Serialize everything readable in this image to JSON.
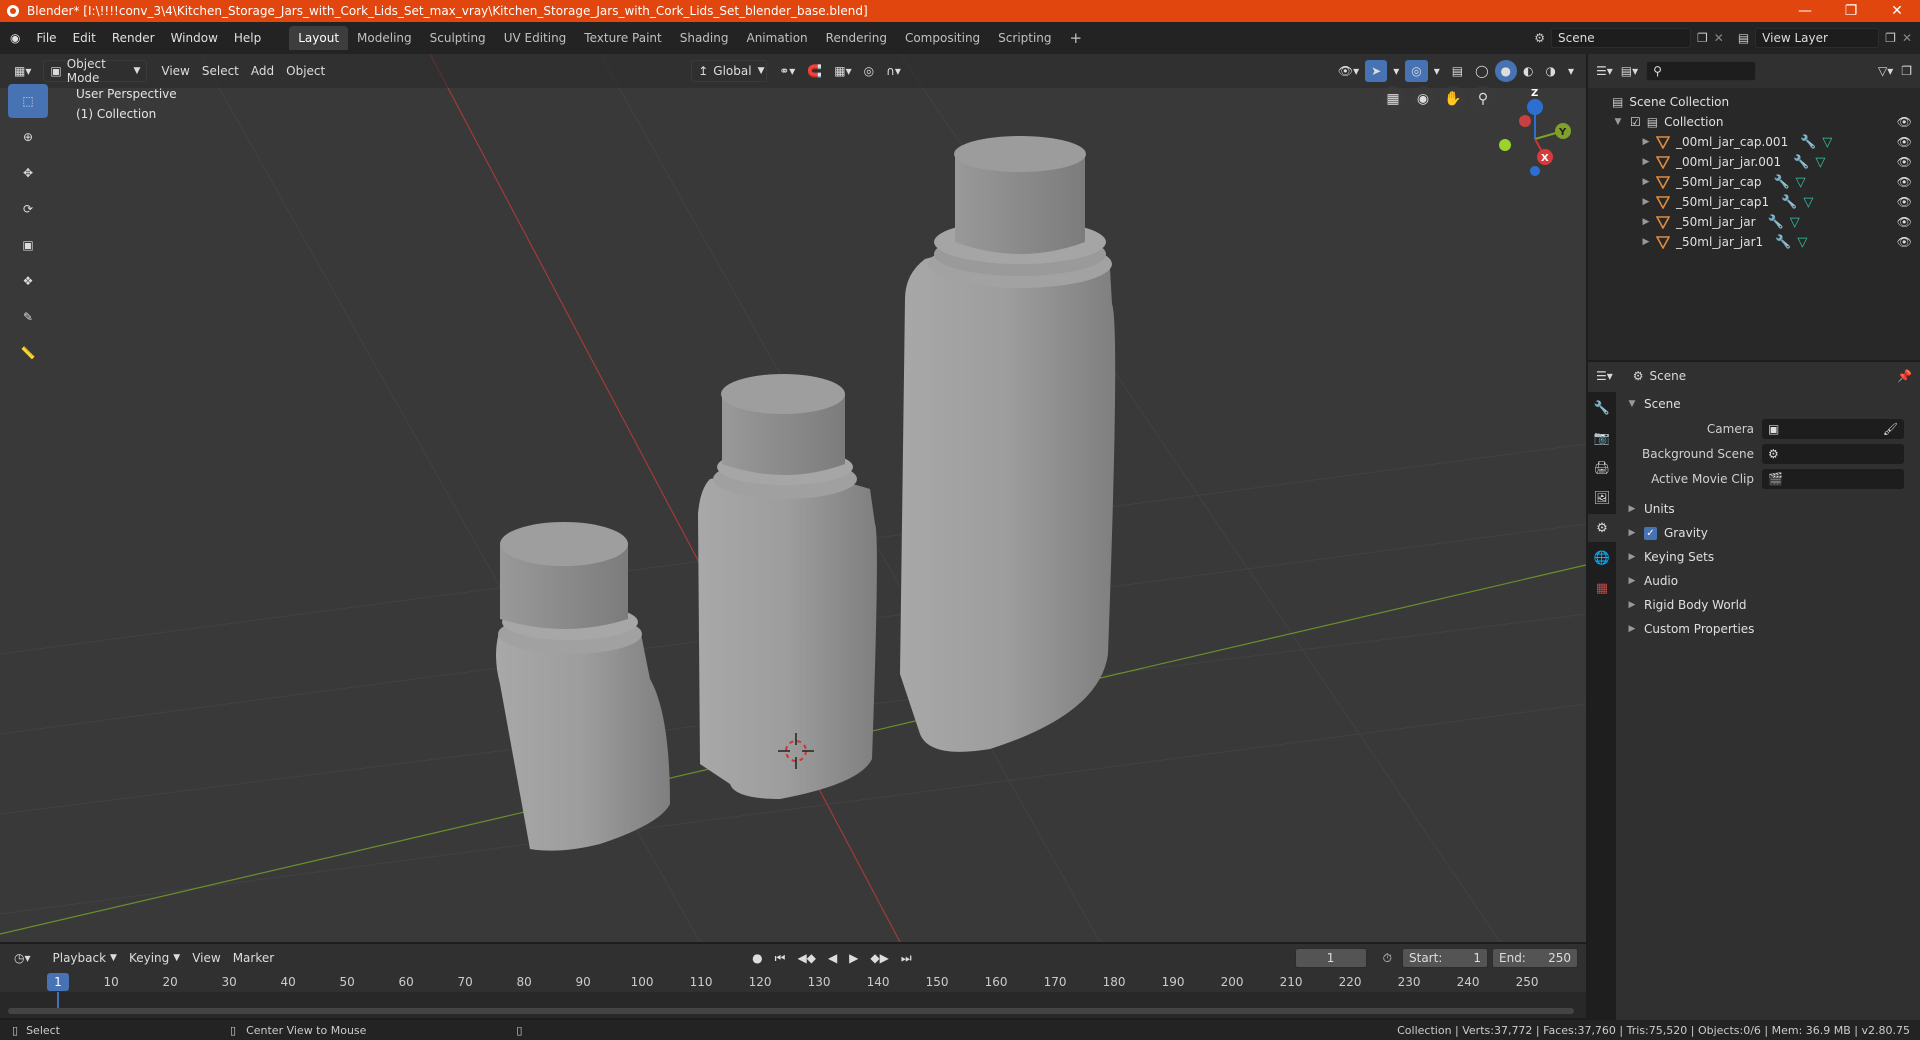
{
  "window": {
    "title": "Blender* [I:\\!!!!conv_3\\4\\Kitchen_Storage_Jars_with_Cork_Lids_Set_max_vray\\Kitchen_Storage_Jars_with_Cork_Lids_Set_blender_base.blend]"
  },
  "menu": [
    "File",
    "Edit",
    "Render",
    "Window",
    "Help"
  ],
  "workspaces": [
    "Layout",
    "Modeling",
    "Sculpting",
    "UV Editing",
    "Texture Paint",
    "Shading",
    "Animation",
    "Rendering",
    "Compositing",
    "Scripting"
  ],
  "active_workspace": "Layout",
  "scene_field": "Scene",
  "view_layer_field": "View Layer",
  "viewport": {
    "mode": "Object Mode",
    "menus": [
      "View",
      "Select",
      "Add",
      "Object"
    ],
    "orientation": "Global",
    "info_line1": "User Perspective",
    "info_line2": "(1) Collection",
    "gizmo_axes": {
      "x": "X",
      "y": "Y",
      "z": "Z"
    }
  },
  "outliner": {
    "root": "Scene Collection",
    "collection": "Collection",
    "items": [
      "_00ml_jar_cap.001",
      "_00ml_jar_jar.001",
      "_50ml_jar_cap",
      "_50ml_jar_cap1",
      "_50ml_jar_jar",
      "_50ml_jar_jar1"
    ]
  },
  "properties": {
    "context": "Scene",
    "section": "Scene",
    "rows": [
      {
        "label": "Camera",
        "value": ""
      },
      {
        "label": "Background Scene",
        "value": ""
      },
      {
        "label": "Active Movie Clip",
        "value": ""
      }
    ],
    "panels": [
      "Units",
      "Gravity",
      "Keying Sets",
      "Audio",
      "Rigid Body World",
      "Custom Properties"
    ],
    "gravity_checked": true
  },
  "timeline": {
    "menus": [
      "Playback",
      "Keying",
      "View",
      "Marker"
    ],
    "current_frame": "1",
    "start_label": "Start:",
    "start": "1",
    "end_label": "End:",
    "end": "250",
    "ticks": [
      "1",
      "10",
      "20",
      "30",
      "40",
      "50",
      "60",
      "70",
      "80",
      "90",
      "100",
      "110",
      "120",
      "130",
      "140",
      "150",
      "160",
      "170",
      "180",
      "190",
      "200",
      "210",
      "220",
      "230",
      "240",
      "250"
    ]
  },
  "status": {
    "left_action": "Select",
    "mid_action": "Center View to Mouse",
    "right": "Collection | Verts:37,772 | Faces:37,760 | Tris:75,520 | Objects:0/6 | Mem: 36.9 MB | v2.80.75"
  },
  "colors": {
    "titlebar": "#e0460e",
    "accent": "#4772b3",
    "x_axis": "#a33a3a",
    "y_axis": "#6a8f2c",
    "mesh_icon": "#e08a3c"
  }
}
